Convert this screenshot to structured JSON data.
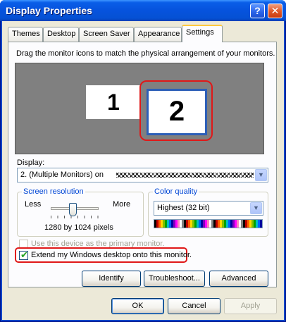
{
  "window": {
    "title": "Display Properties",
    "help_glyph": "?",
    "close_glyph": "✕"
  },
  "tabs": [
    {
      "label": "Themes"
    },
    {
      "label": "Desktop"
    },
    {
      "label": "Screen Saver"
    },
    {
      "label": "Appearance"
    },
    {
      "label": "Settings",
      "active": true
    }
  ],
  "settings": {
    "instructions": "Drag the monitor icons to match the physical arrangement of your monitors.",
    "monitors": [
      {
        "number": "1",
        "selected": false
      },
      {
        "number": "2",
        "selected": true
      }
    ],
    "display_label": "Display:",
    "display_value": "2. (Multiple Monitors) on",
    "screen_resolution": {
      "group_label": "Screen resolution",
      "less_label": "Less",
      "more_label": "More",
      "value_text": "1280 by 1024 pixels",
      "slider_fraction": 0.5
    },
    "color_quality": {
      "group_label": "Color quality",
      "value": "Highest (32 bit)"
    },
    "primary_monitor": {
      "label": "Use this device as the primary monitor.",
      "checked": false,
      "enabled": false
    },
    "extend_desktop": {
      "label": "Extend my Windows desktop onto this monitor.",
      "checked": true,
      "enabled": true
    },
    "buttons": {
      "identify": "Identify",
      "troubleshoot": "Troubleshoot...",
      "advanced": "Advanced"
    }
  },
  "dialog_buttons": {
    "ok": "OK",
    "cancel": "Cancel",
    "apply": "Apply",
    "apply_enabled": false
  },
  "colors": {
    "titlebar": "#0653dd",
    "highlight_ring": "#e01818",
    "group_label": "#0046d5",
    "dialog_bg": "#ece9d8"
  }
}
